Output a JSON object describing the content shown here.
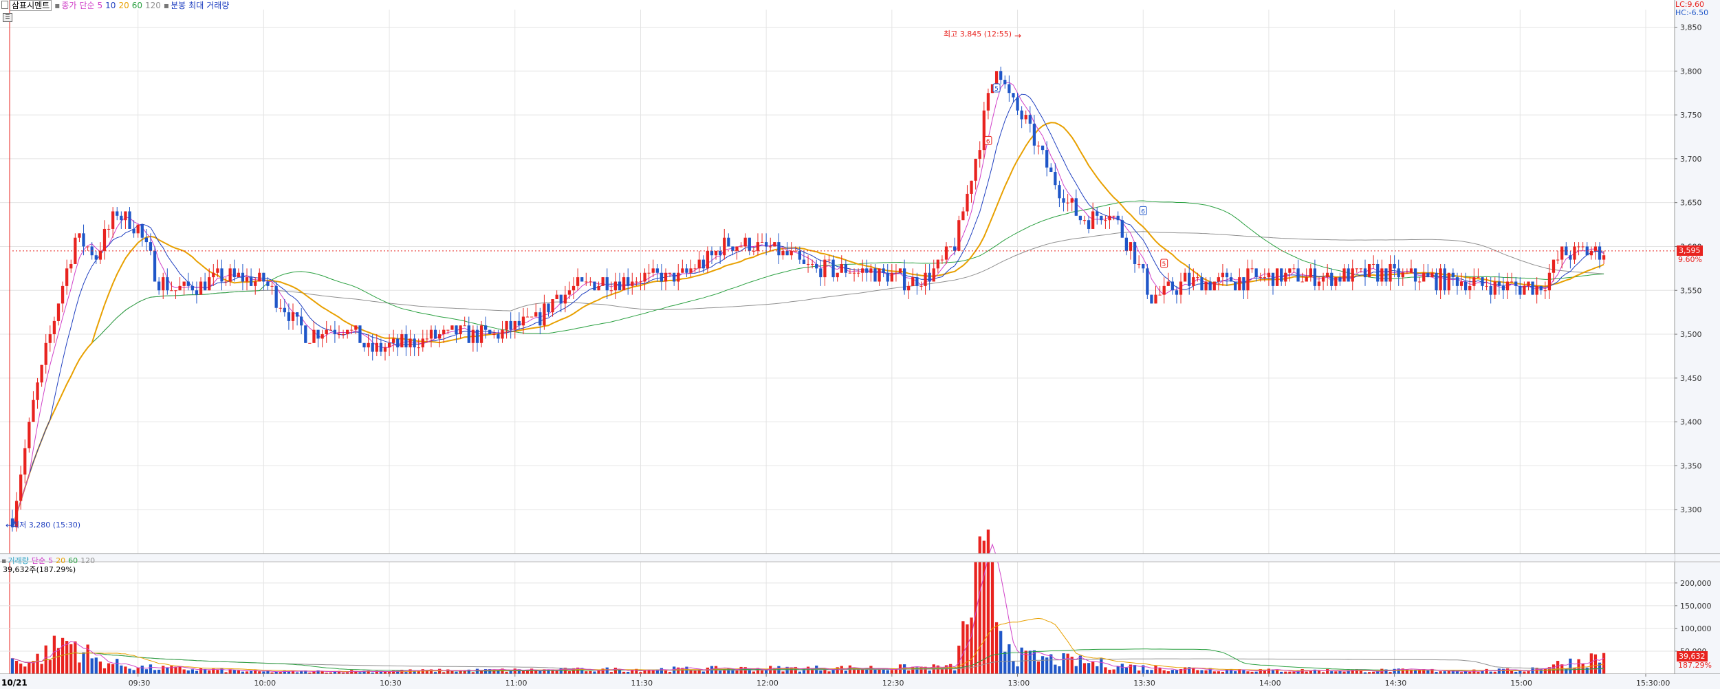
{
  "price_legend": {
    "label_main": "삼표시멘트",
    "label_close": "종가",
    "label_simple": "단순",
    "ma_periods": [
      "5",
      "10",
      "20",
      "60",
      "120"
    ],
    "label_candle": "분봉",
    "label_maxmin": "최대",
    "label_volume": "거래량"
  },
  "volume_legend": {
    "label_volume": "거래량",
    "label_simple": "단순",
    "ma_periods": [
      "5",
      "20",
      "60",
      "120"
    ],
    "current_text": "39,632주(187.29%)"
  },
  "lc_text": "LC:9.60",
  "hc_text": "HC:-6.50",
  "date_label": "10/21",
  "current_price": "3,595",
  "current_pct": "9.60%",
  "current_volume": "39,632",
  "current_volume_pct": "187.29%",
  "high_annotation": "최고 3,845 (12:55)",
  "low_annotation": "최저 3,280 (15:30)",
  "signal_labels": [
    "5",
    "6",
    "6",
    "5"
  ],
  "colors": {
    "up": "#e8231f",
    "down": "#1f56c8",
    "ma5": "#d040c8",
    "ma10": "#1f3fc0",
    "ma20": "#e8a000",
    "ma60": "#2aa040",
    "ma120": "#909090"
  },
  "chart_data": [
    {
      "type": "candlestick",
      "title": "삼표시멘트 분봉",
      "interval_minutes": 1,
      "y_ticks": [
        3300,
        3350,
        3400,
        3450,
        3500,
        3550,
        3600,
        3650,
        3700,
        3750,
        3800,
        3850
      ],
      "y_tick_labels": [
        "3,300",
        "3,350",
        "3,400",
        "3,450",
        "3,500",
        "3,550",
        "3,600",
        "3,650",
        "3,700",
        "3,750",
        "3,800",
        "3,850"
      ],
      "ylim": [
        3250,
        3870
      ],
      "x_tick_labels": [
        "09:30",
        "10:00",
        "10:30",
        "11:00",
        "11:30",
        "12:00",
        "12:30",
        "13:00",
        "13:30",
        "14:00",
        "14:30",
        "15:00",
        "15:30:00"
      ],
      "grid": true,
      "key_points": [
        {
          "time": "09:00",
          "close": 3290
        },
        {
          "time": "09:05",
          "close": 3420
        },
        {
          "time": "09:10",
          "close": 3520
        },
        {
          "time": "09:15",
          "close": 3610
        },
        {
          "time": "09:20",
          "close": 3590
        },
        {
          "time": "09:25",
          "close": 3640
        },
        {
          "time": "09:30",
          "close": 3620
        },
        {
          "time": "09:35",
          "close": 3560
        },
        {
          "time": "09:40",
          "close": 3550
        },
        {
          "time": "09:50",
          "close": 3565
        },
        {
          "time": "10:00",
          "close": 3560
        },
        {
          "time": "10:10",
          "close": 3500
        },
        {
          "time": "10:20",
          "close": 3510
        },
        {
          "time": "10:25",
          "close": 3480
        },
        {
          "time": "10:35",
          "close": 3490
        },
        {
          "time": "10:45",
          "close": 3500
        },
        {
          "time": "10:55",
          "close": 3500
        },
        {
          "time": "11:05",
          "close": 3515
        },
        {
          "time": "11:10",
          "close": 3545
        },
        {
          "time": "11:20",
          "close": 3560
        },
        {
          "time": "11:30",
          "close": 3565
        },
        {
          "time": "11:40",
          "close": 3565
        },
        {
          "time": "11:50",
          "close": 3600
        },
        {
          "time": "11:55",
          "close": 3605
        },
        {
          "time": "12:05",
          "close": 3590
        },
        {
          "time": "12:10",
          "close": 3575
        },
        {
          "time": "12:25",
          "close": 3570
        },
        {
          "time": "12:35",
          "close": 3560
        },
        {
          "time": "12:40",
          "close": 3570
        },
        {
          "time": "12:45",
          "close": 3600
        },
        {
          "time": "12:50",
          "close": 3700
        },
        {
          "time": "12:55",
          "close": 3810
        },
        {
          "time": "12:58",
          "close": 3770
        },
        {
          "time": "13:02",
          "close": 3740
        },
        {
          "time": "13:08",
          "close": 3680
        },
        {
          "time": "13:15",
          "close": 3630
        },
        {
          "time": "13:22",
          "close": 3640
        },
        {
          "time": "13:27",
          "close": 3600
        },
        {
          "time": "13:32",
          "close": 3540
        },
        {
          "time": "13:40",
          "close": 3560
        },
        {
          "time": "13:50",
          "close": 3560
        },
        {
          "time": "14:00",
          "close": 3565
        },
        {
          "time": "14:15",
          "close": 3565
        },
        {
          "time": "14:25",
          "close": 3570
        },
        {
          "time": "14:35",
          "close": 3565
        },
        {
          "time": "14:45",
          "close": 3560
        },
        {
          "time": "14:55",
          "close": 3555
        },
        {
          "time": "15:05",
          "close": 3555
        },
        {
          "time": "15:10",
          "close": 3590
        },
        {
          "time": "15:15",
          "close": 3595
        },
        {
          "time": "15:20",
          "close": 3595
        }
      ],
      "high": {
        "time": "12:55",
        "value": 3845
      },
      "low": {
        "time": "15:30",
        "value": 3280
      }
    },
    {
      "type": "bar",
      "title": "거래량",
      "y_ticks": [
        50000,
        100000,
        150000,
        200000
      ],
      "y_tick_labels": [
        "50,000",
        "100,000",
        "150,000",
        "200,000"
      ],
      "ylim": [
        0,
        230000
      ],
      "key_points": [
        {
          "time": "09:05",
          "value": 30000
        },
        {
          "time": "09:10",
          "value": 60000
        },
        {
          "time": "09:12",
          "value": 75000
        },
        {
          "time": "09:15",
          "value": 70000
        },
        {
          "time": "09:20",
          "value": 30000
        },
        {
          "time": "09:30",
          "value": 15000
        },
        {
          "time": "10:00",
          "value": 5000
        },
        {
          "time": "12:45",
          "value": 15000
        },
        {
          "time": "12:50",
          "value": 200000
        },
        {
          "time": "12:53",
          "value": 230000
        },
        {
          "time": "12:56",
          "value": 110000
        },
        {
          "time": "13:00",
          "value": 40000
        },
        {
          "time": "13:30",
          "value": 15000
        },
        {
          "time": "14:00",
          "value": 8000
        },
        {
          "time": "15:00",
          "value": 8000
        },
        {
          "time": "15:20",
          "value": 39632
        }
      ]
    }
  ]
}
